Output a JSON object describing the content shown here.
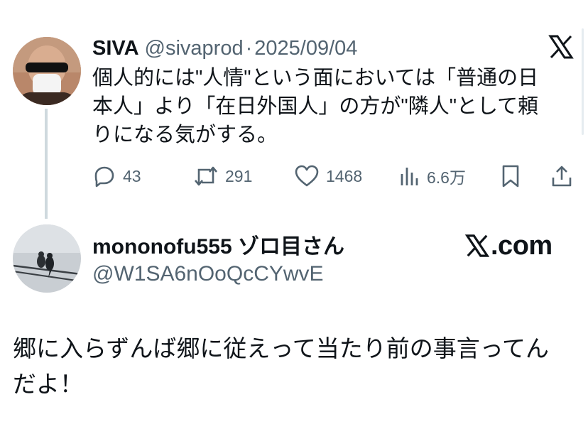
{
  "quoted_tweet": {
    "display_name": "SIVA",
    "handle": "@sivaprod",
    "separator": "·",
    "date": "2025/09/04",
    "text_lines": [
      "個人的には\"人情\"という面においては「普通の日",
      "本人」より「在日外国人」の方が\"隣人\"として頼",
      "りになる気がする。"
    ],
    "metrics": {
      "replies": "43",
      "reposts": "291",
      "likes": "1468",
      "views": "6.6万"
    },
    "icons": [
      "x-logo-icon",
      "reply-icon",
      "repost-icon",
      "like-icon",
      "views-icon",
      "bookmark-icon",
      "share-icon"
    ]
  },
  "reply": {
    "display_name": "mononofu555 ゾロ目さん",
    "handle": "@W1SA6nOoQcCYwvE",
    "source_badge": ".com",
    "text_lines": [
      "郷に入らずんば郷に従えって当たり前の事言ってん",
      "だよ！"
    ]
  },
  "colors": {
    "text": "#0f1419",
    "secondary": "#536471",
    "thread_line": "#cfd9de"
  }
}
